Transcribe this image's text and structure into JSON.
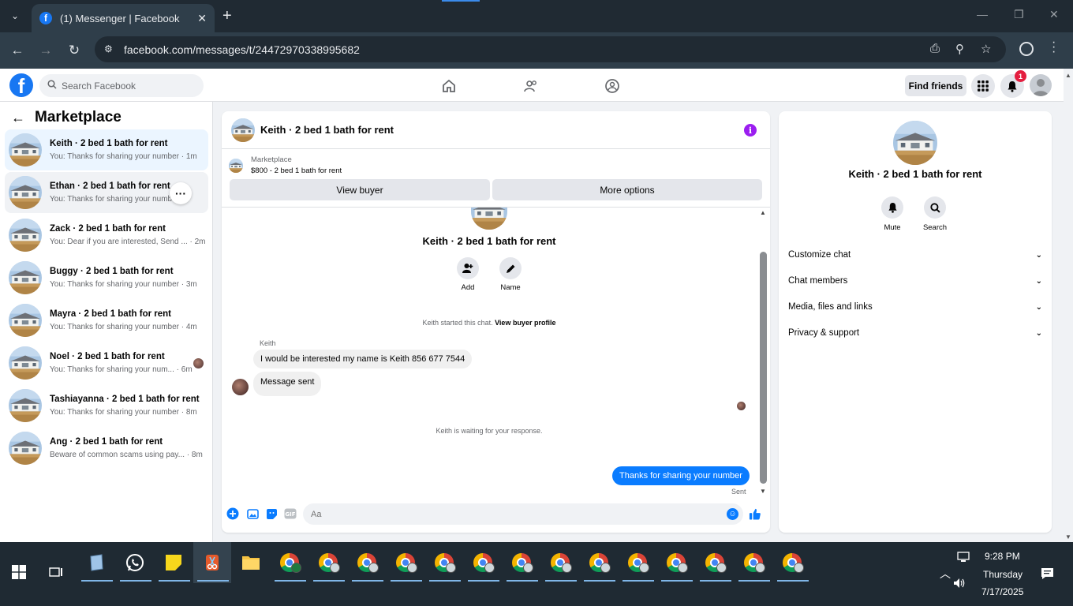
{
  "browser": {
    "tab_title": "(1) Messenger | Facebook",
    "url": "facebook.com/messages/t/24472970338995682"
  },
  "fb": {
    "search_placeholder": "Search Facebook",
    "find_friends": "Find friends",
    "notif_count": "1"
  },
  "sidebar": {
    "title": "Marketplace",
    "conversations": [
      {
        "name": "Keith · 2 bed 1 bath for rent",
        "preview": "You: Thanks for sharing your number · 1m"
      },
      {
        "name": "Ethan · 2 bed 1 bath for rent",
        "preview": "You: Thanks for sharing your number"
      },
      {
        "name": "Zack · 2 bed 1 bath for rent",
        "preview": "You: Dear if you are interested, Send ... · 2m"
      },
      {
        "name": "Buggy · 2 bed 1 bath for rent",
        "preview": "You: Thanks for sharing your number · 3m"
      },
      {
        "name": "Mayra · 2 bed 1 bath for rent",
        "preview": "You: Thanks for sharing your number · 4m"
      },
      {
        "name": "Noel · 2 bed 1 bath for rent",
        "preview": "You: Thanks for sharing your num... · 6m"
      },
      {
        "name": "Tashiayanna · 2 bed 1 bath for rent",
        "preview": "You: Thanks for sharing your number · 8m"
      },
      {
        "name": "Ang · 2 bed 1 bath for rent",
        "preview": "Beware of common scams using pay... · 8m"
      }
    ]
  },
  "chat": {
    "header_name": "Keith · 2 bed 1 bath for rent",
    "marketplace_label": "Marketplace",
    "listing": "$800 - 2 bed 1 bath for rent",
    "view_buyer": "View buyer",
    "more_options": "More options",
    "title": "Keith · 2 bed 1 bath for rent",
    "add_label": "Add",
    "name_label": "Name",
    "started_text": "Keith started this chat.",
    "view_buyer_profile": "View buyer profile",
    "sender": "Keith",
    "msg1": "I would be interested my name is Keith 856 677 7544",
    "msg2": "Message sent",
    "waiting": "Keith is waiting for your response.",
    "my_msg": "Thanks for sharing your number",
    "sent_status": "Sent",
    "input_placeholder": "Aa"
  },
  "panel": {
    "title": "Keith · 2 bed 1 bath for rent",
    "mute": "Mute",
    "search": "Search",
    "items": [
      "Customize chat",
      "Chat members",
      "Media, files and links",
      "Privacy & support"
    ]
  },
  "taskbar": {
    "time": "9:28 PM",
    "day": "Thursday",
    "date": "7/17/2025"
  },
  "colors": {
    "fb_blue": "#1877f2",
    "messenger_blue": "#0a7cff",
    "info_purple": "#9b1ef0",
    "badge_red": "#e41e3f"
  }
}
